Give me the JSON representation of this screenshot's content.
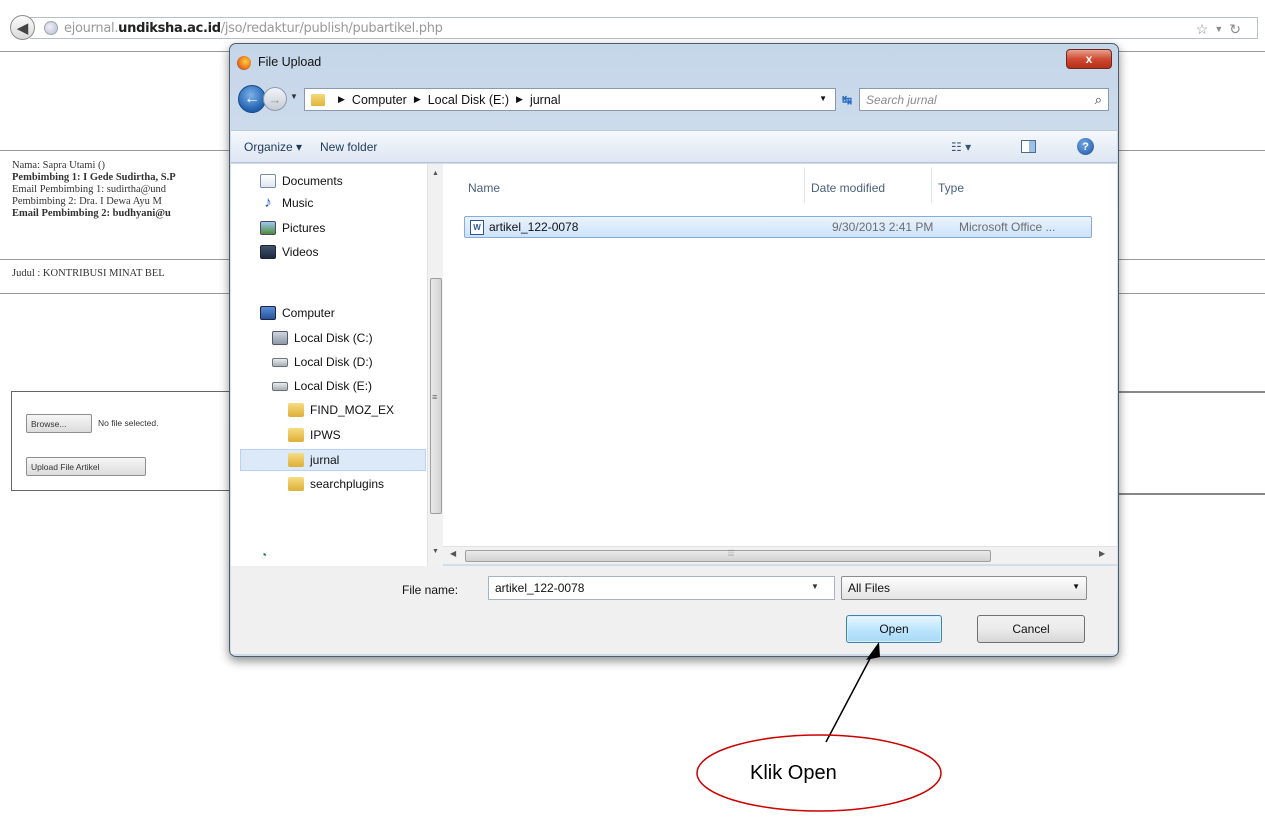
{
  "browser": {
    "url_prefix": "ejournal.",
    "url_domain": "undiksha.ac.id",
    "url_path": "/jso/redaktur/publish/pubartikel.php",
    "icons": [
      "back-arrow-icon",
      "globe-icon",
      "star-icon",
      "dropdown-icon",
      "refresh-icon"
    ]
  },
  "page": {
    "info_lines": [
      "Nama: Sapra Utami ()",
      "Pembimbing 1: I Gede Sudirtha, S.P",
      "Email Pembimbing 1: sudirtha@und",
      "Pembimbing 2: Dra. I Dewa Ayu M",
      "Email Pembimbing 2: budhyani@u"
    ],
    "judul": "Judul : KONTRIBUSI MINAT BEL",
    "browse_label": "Browse...",
    "no_file_text": "No file selected.",
    "upload_label": "Upload File Artikel"
  },
  "dialog": {
    "title": "File Upload",
    "close_label": "x",
    "breadcrumb": [
      "Computer",
      "Local Disk (E:)",
      "jurnal"
    ],
    "search_placeholder": "Search jurnal",
    "toolbar": {
      "organize": "Organize ▾",
      "new_folder": "New folder"
    },
    "nav_items": [
      {
        "label": "Documents",
        "icon": "documents-icon"
      },
      {
        "label": "Music",
        "icon": "music-icon"
      },
      {
        "label": "Pictures",
        "icon": "pictures-icon"
      },
      {
        "label": "Videos",
        "icon": "videos-icon"
      },
      {
        "label": "Computer",
        "icon": "computer-icon"
      },
      {
        "label": "Local Disk (C:)",
        "icon": "disk-icon"
      },
      {
        "label": "Local Disk (D:)",
        "icon": "disk-icon"
      },
      {
        "label": "Local Disk (E:)",
        "icon": "disk-icon"
      },
      {
        "label": "FIND_MOZ_EX",
        "icon": "folder-icon"
      },
      {
        "label": "IPWS",
        "icon": "folder-icon"
      },
      {
        "label": "jurnal",
        "icon": "folder-icon",
        "selected": true
      },
      {
        "label": "searchplugins",
        "icon": "folder-icon"
      }
    ],
    "columns": {
      "name": "Name",
      "date": "Date modified",
      "type": "Type"
    },
    "files": [
      {
        "name": "artikel_122-0078",
        "date": "9/30/2013 2:41 PM",
        "type": "Microsoft Office ..."
      }
    ],
    "file_name_label": "File name:",
    "file_name_value": "artikel_122-0078",
    "file_type_value": "All Files",
    "open_label": "Open",
    "cancel_label": "Cancel"
  },
  "annotation": {
    "callout": "Klik Open",
    "color": "#cc0000"
  }
}
